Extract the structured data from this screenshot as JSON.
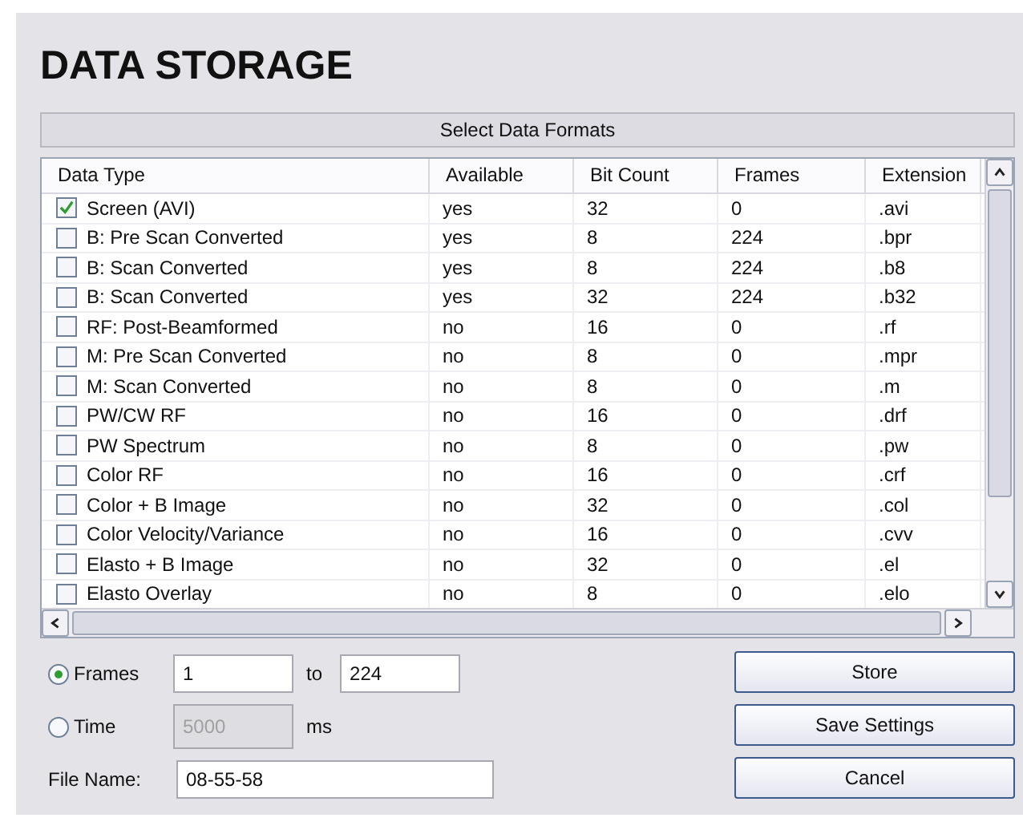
{
  "title": "DATA STORAGE",
  "section_header": "Select Data Formats",
  "table": {
    "columns": [
      "Data Type",
      "Available",
      "Bit Count",
      "Frames",
      "Extension"
    ],
    "rows": [
      {
        "checked": true,
        "cells": [
          "Screen (AVI)",
          "yes",
          "32",
          "0",
          ".avi"
        ]
      },
      {
        "checked": false,
        "cells": [
          "B: Pre Scan Converted",
          "yes",
          "8",
          "224",
          ".bpr"
        ]
      },
      {
        "checked": false,
        "cells": [
          "B: Scan Converted",
          "yes",
          "8",
          "224",
          ".b8"
        ]
      },
      {
        "checked": false,
        "cells": [
          "B: Scan Converted",
          "yes",
          "32",
          "224",
          ".b32"
        ]
      },
      {
        "checked": false,
        "cells": [
          "RF: Post-Beamformed",
          "no",
          "16",
          "0",
          ".rf"
        ]
      },
      {
        "checked": false,
        "cells": [
          "M: Pre Scan Converted",
          "no",
          "8",
          "0",
          ".mpr"
        ]
      },
      {
        "checked": false,
        "cells": [
          "M: Scan Converted",
          "no",
          "8",
          "0",
          ".m"
        ]
      },
      {
        "checked": false,
        "cells": [
          "PW/CW RF",
          "no",
          "16",
          "0",
          ".drf"
        ]
      },
      {
        "checked": false,
        "cells": [
          "PW Spectrum",
          "no",
          "8",
          "0",
          ".pw"
        ]
      },
      {
        "checked": false,
        "cells": [
          "Color RF",
          "no",
          "16",
          "0",
          ".crf"
        ]
      },
      {
        "checked": false,
        "cells": [
          "Color + B Image",
          "no",
          "32",
          "0",
          ".col"
        ]
      },
      {
        "checked": false,
        "cells": [
          "Color Velocity/Variance",
          "no",
          "16",
          "0",
          ".cvv"
        ]
      },
      {
        "checked": false,
        "cells": [
          "Elasto + B Image",
          "no",
          "32",
          "0",
          ".el"
        ]
      },
      {
        "checked": false,
        "cells": [
          "Elasto Overlay",
          "no",
          "8",
          "0",
          ".elo"
        ]
      }
    ]
  },
  "range": [
    {
      "label": "Frames",
      "selected": true,
      "from": "1",
      "to_label": "to",
      "to": "224"
    },
    {
      "label": "Time",
      "selected": false,
      "value": "5000",
      "disabled": true,
      "unit": "ms"
    }
  ],
  "file_name": {
    "label": "File Name:",
    "value": "08-55-58"
  },
  "buttons": [
    "Store",
    "Save Settings",
    "Cancel"
  ]
}
